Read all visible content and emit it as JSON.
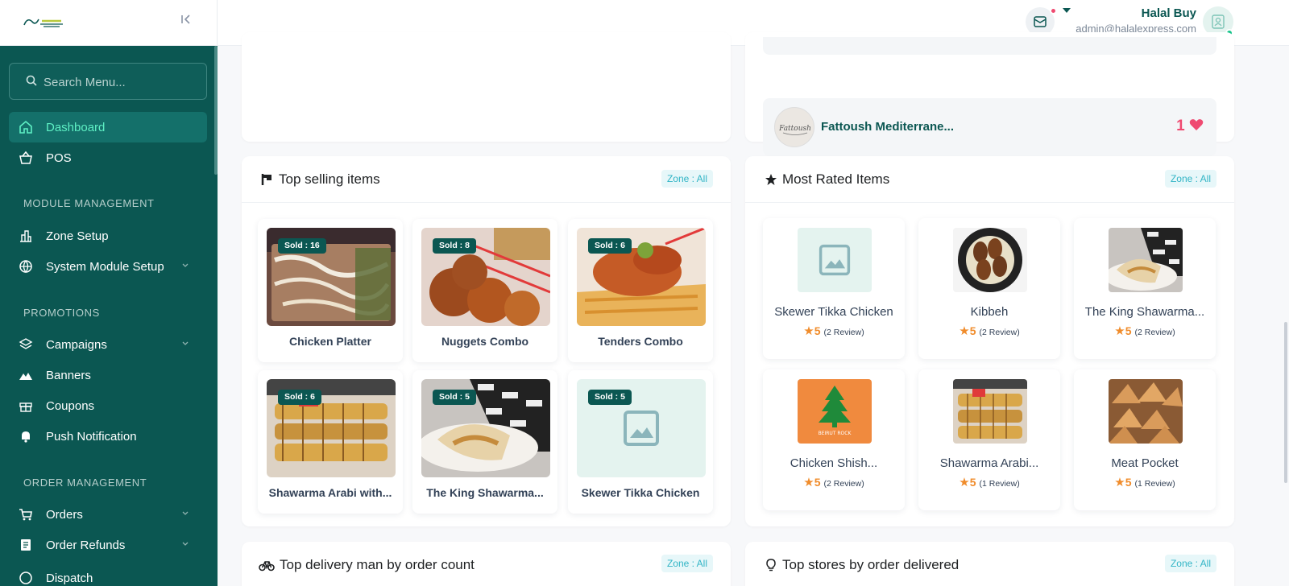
{
  "sidebar": {
    "search_placeholder": "Search Menu...",
    "items": {
      "dashboard": "Dashboard",
      "pos": "POS",
      "zone_setup": "Zone Setup",
      "system_module_setup": "System Module Setup",
      "campaigns": "Campaigns",
      "banners": "Banners",
      "coupons": "Coupons",
      "push_notification": "Push Notification",
      "orders": "Orders",
      "order_refunds": "Order Refunds",
      "dispatch": "Dispatch"
    },
    "sections": {
      "module_management": "MODULE MANAGEMENT",
      "promotions": "PROMOTIONS",
      "order_management": "ORDER MANAGEMENT"
    }
  },
  "header": {
    "user_name": "Halal Buy",
    "user_email": "admin@halalexpress.com"
  },
  "popular_store": {
    "name": "Fattoush Mediterrane...",
    "likes": "1"
  },
  "top_selling": {
    "title": "Top selling items",
    "zone": "Zone : All",
    "items": [
      {
        "name": "Chicken Platter",
        "sold": "Sold : 16"
      },
      {
        "name": "Nuggets Combo",
        "sold": "Sold : 8"
      },
      {
        "name": "Tenders Combo",
        "sold": "Sold : 6"
      },
      {
        "name": "Shawarma Arabi with...",
        "sold": "Sold : 6"
      },
      {
        "name": "The King Shawarma...",
        "sold": "Sold : 5"
      },
      {
        "name": "Skewer Tikka Chicken",
        "sold": "Sold : 5"
      }
    ]
  },
  "most_rated": {
    "title": "Most Rated Items",
    "zone": "Zone : All",
    "items": [
      {
        "name": "Skewer Tikka Chicken",
        "rating": "5",
        "reviews": "(2 Review)"
      },
      {
        "name": "Kibbeh",
        "rating": "5",
        "reviews": "(2 Review)"
      },
      {
        "name": "The King Shawarma...",
        "rating": "5",
        "reviews": "(2 Review)"
      },
      {
        "name": "Chicken Shish...",
        "rating": "5",
        "reviews": "(2 Review)"
      },
      {
        "name": "Shawarma Arabi...",
        "rating": "5",
        "reviews": "(1 Review)"
      },
      {
        "name": "Meat Pocket",
        "rating": "5",
        "reviews": "(1 Review)"
      }
    ]
  },
  "top_delivery": {
    "title": "Top delivery man by order count",
    "zone": "Zone : All"
  },
  "top_stores": {
    "title": "Top stores by order delivered",
    "zone": "Zone : All"
  },
  "colors": {
    "brand": "#0b5752",
    "active_text": "#5ef0c4",
    "sold_badge": "#0b5752",
    "star": "#f08c2b",
    "heart": "#ef4a71",
    "zone_badge_text": "#33b5c6"
  },
  "icons": [
    "search-icon",
    "home-icon",
    "basket-icon",
    "building-icon",
    "globe-icon",
    "layers-icon",
    "mountain-icon",
    "gift-icon",
    "bell-icon",
    "cart-icon",
    "receipt-icon",
    "mail-icon",
    "heart-icon",
    "star-icon",
    "bicycle-icon",
    "bulb-icon",
    "image-placeholder-icon"
  ]
}
